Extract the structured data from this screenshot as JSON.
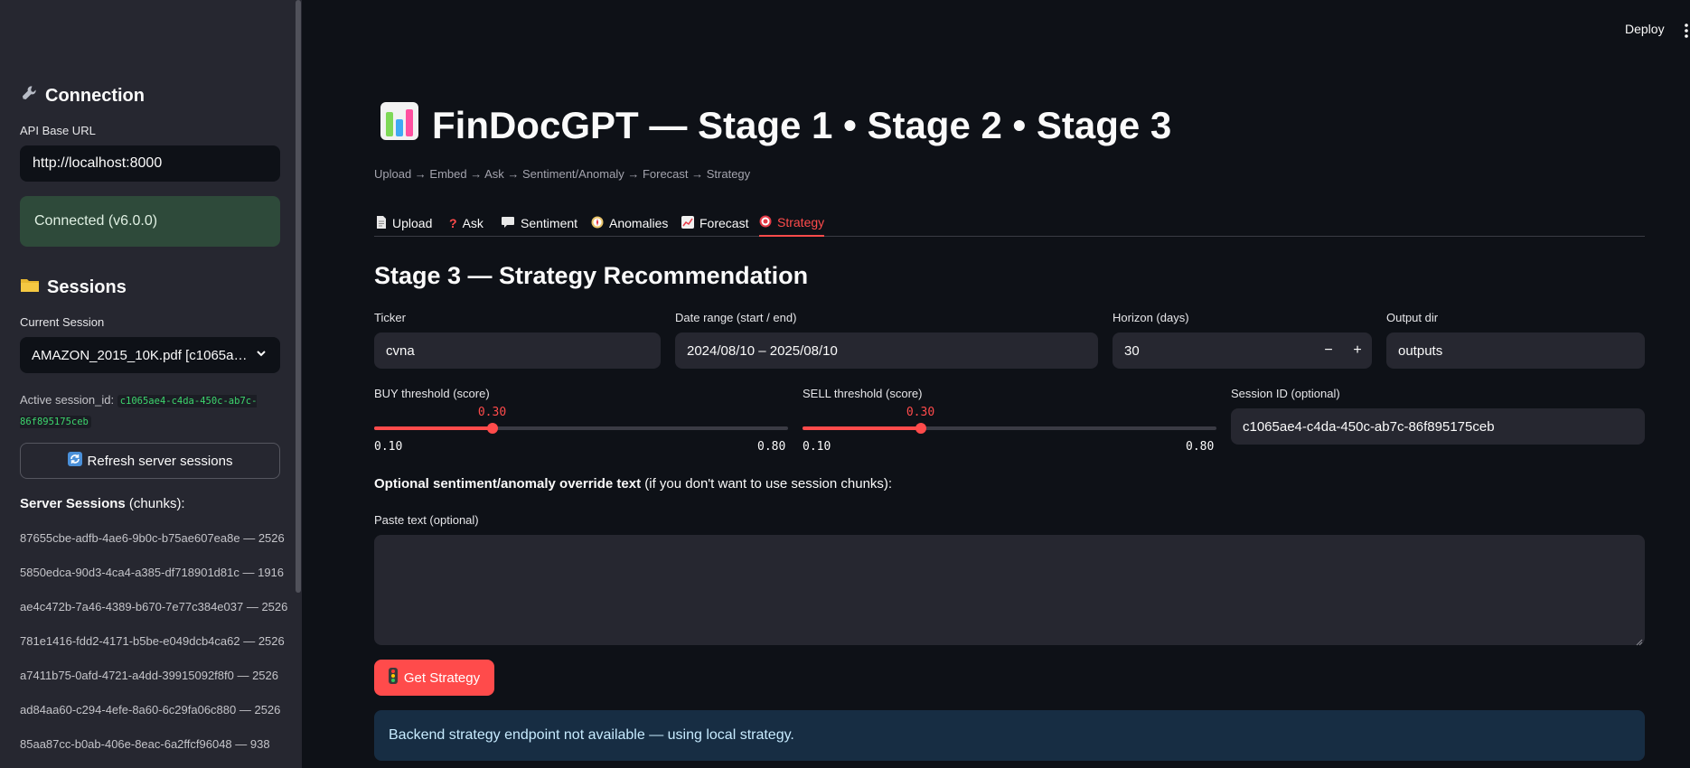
{
  "header": {
    "deploy_label": "Deploy"
  },
  "sidebar": {
    "connection_heading": "Connection",
    "api_label": "API Base URL",
    "api_value": "http://localhost:8000",
    "status": "Connected (v6.0.0)",
    "sessions_heading": "Sessions",
    "current_session_label": "Current Session",
    "current_session_value": "AMAZON_2015_10K.pdf [c1065a…",
    "active_label": "Active session_id:",
    "active_id": "c1065ae4-c4da-450c-ab7c-86f895175ceb",
    "refresh_label": "Refresh server sessions",
    "server_sessions_bold": "Server Sessions",
    "server_sessions_rest": " (chunks):",
    "server_sessions": [
      "87655cbe-adfb-4ae6-9b0c-b75ae607ea8e — 2526",
      "5850edca-90d3-4ca4-a385-df718901d81c — 1916",
      "ae4c472b-7a46-4389-b670-7e77c384e037 — 2526",
      "781e1416-fdd2-4171-b5be-e049dcb4ca62 — 2526",
      "a7411b75-0afd-4721-a4dd-39915092f8f0 — 2526",
      "ad84aa60-c294-4efe-8a60-6c29fa06c880 — 2526",
      "85aa87cc-b0ab-406e-8eac-6a2ffcf96048 — 938"
    ]
  },
  "main": {
    "title": "FinDocGPT — Stage 1 • Stage 2 • Stage 3",
    "caption": "Upload → Embed → Ask → Sentiment/Anomaly → Forecast → Strategy",
    "tabs": [
      {
        "label": "Upload",
        "icon": "document-icon"
      },
      {
        "label": "Ask",
        "icon": "question-icon"
      },
      {
        "label": "Sentiment",
        "icon": "speech-bubble-icon"
      },
      {
        "label": "Anomalies",
        "icon": "compass-icon"
      },
      {
        "label": "Forecast",
        "icon": "chart-up-icon"
      },
      {
        "label": "Strategy",
        "icon": "target-icon",
        "active": true
      }
    ],
    "section_title": "Stage 3 — Strategy Recommendation",
    "ticker_label": "Ticker",
    "ticker_value": "cvna",
    "date_label": "Date range (start / end)",
    "date_value": "2024/08/10 – 2025/08/10",
    "horizon_label": "Horizon (days)",
    "horizon_value": "30",
    "minus": "−",
    "plus": "+",
    "outdir_label": "Output dir",
    "outdir_value": "outputs",
    "buy_label": "BUY threshold (score)",
    "buy_value": "0.30",
    "buy_fraction": 0.2857,
    "buy_min": "0.10",
    "buy_max": "0.80",
    "sell_label": "SELL threshold (score)",
    "sell_value": "0.30",
    "sell_fraction": 0.2857,
    "sell_min": "0.10",
    "sell_max": "0.80",
    "session_label": "Session ID (optional)",
    "session_value": "c1065ae4-c4da-450c-ab7c-86f895175ceb",
    "override_bold": "Optional sentiment/anomaly override text",
    "override_rest": " (if you don't want to use session chunks):",
    "paste_label": "Paste text (optional)",
    "paste_value": "",
    "get_strategy_label": "Get Strategy",
    "info_message": "Backend strategy endpoint not available — using local strategy."
  },
  "colors": {
    "accent": "#ff4b4b",
    "success_bg": "#2e4a3a",
    "info_bg": "#172d43",
    "sidebar_bg": "#262730",
    "app_bg": "#0e1117"
  }
}
